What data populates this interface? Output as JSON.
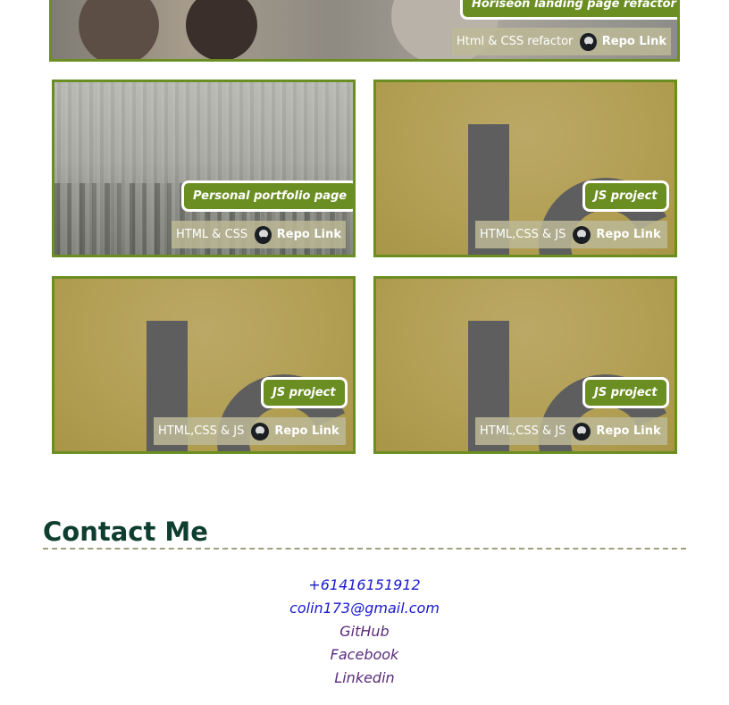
{
  "projects": [
    {
      "title": "Horiseon landing page refactor",
      "tech": "Html & CSS refactor",
      "repo_label": "Repo Link"
    },
    {
      "title": "Personal portfolio page",
      "tech": "HTML & CSS",
      "repo_label": "Repo Link"
    },
    {
      "title": "JS project",
      "tech": "HTML,CSS & JS",
      "repo_label": "Repo Link"
    },
    {
      "title": "JS project",
      "tech": "HTML,CSS & JS",
      "repo_label": "Repo Link"
    },
    {
      "title": "JS project",
      "tech": "HTML,CSS & JS",
      "repo_label": "Repo Link"
    }
  ],
  "contact": {
    "heading": "Contact Me",
    "links": [
      {
        "label": "+61416151912",
        "color": "#1a1ad0"
      },
      {
        "label": "colin173@gmail.com",
        "color": "#1a1ad0"
      },
      {
        "label": "GitHub",
        "color": "#5a2a7a"
      },
      {
        "label": "Facebook",
        "color": "#5a2a7a"
      },
      {
        "label": "Linkedin",
        "color": "#5a2a7a"
      }
    ]
  },
  "colors": {
    "accent": "#6b8e23",
    "heading": "#0e3e2f",
    "link_unvisited": "#1a1ad0",
    "link_visited": "#5a2a7a"
  },
  "icons": {
    "repo": "github-icon"
  }
}
